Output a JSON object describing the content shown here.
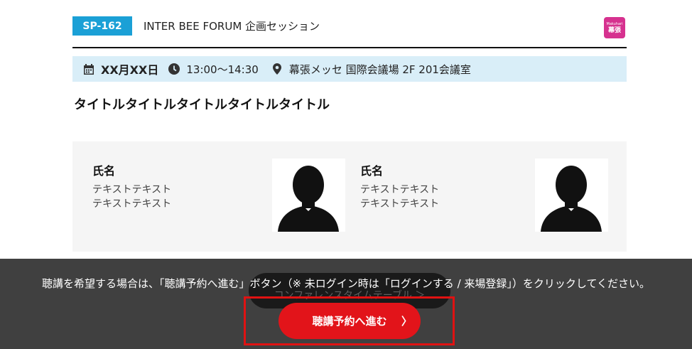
{
  "session": {
    "code": "SP-162",
    "title": "INTER BEE FORUM 企画セッション",
    "venue_logo": {
      "line1": "Makuhari",
      "line2": "幕張"
    },
    "date": "XX月XX日",
    "time": "13:00〜14:30",
    "location": "幕張メッセ 国際会議場 2F 201会議室",
    "heading": "タイトルタイトルタイトルタイトルタイトル"
  },
  "speakers": [
    {
      "name": "氏名",
      "desc_line1": "テキストテキスト",
      "desc_line2": "テキストテキスト"
    },
    {
      "name": "氏名",
      "desc_line1": "テキストテキスト",
      "desc_line2": "テキストテキスト"
    }
  ],
  "overlay": {
    "notice": "聴講を希望する場合は、「聴講予約へ進む」ボタン（※ 未ログイン時は「ログインする / 来場登録」）をクリックしてください。",
    "timetable_label": "コンファレンスタイムテーブル ＞",
    "reserve_label": "聴講予約へ進む",
    "reserve_chevron": "〉"
  },
  "colors": {
    "badge": "#1ba0d6",
    "info_bar": "#d9eef8",
    "reserve_button": "#e2141a",
    "highlight": "#e01212",
    "venue_logo": "#d6318f"
  },
  "icons": [
    "calendar-icon",
    "clock-icon",
    "location-pin-icon",
    "speaker-silhouette-icon",
    "chevron-right-icon"
  ]
}
